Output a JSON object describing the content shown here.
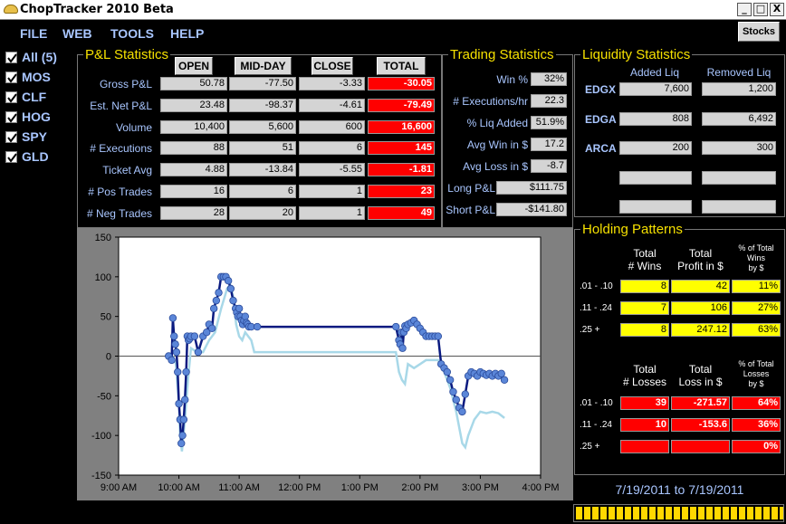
{
  "window": {
    "title": "ChopTracker 2010 Beta",
    "controls": [
      "_",
      "□",
      "X"
    ]
  },
  "menu": [
    "FILE",
    "WEB",
    "TOOLS",
    "HELP"
  ],
  "stocks_button": "Stocks",
  "tickers": [
    {
      "label": "All (5)",
      "checked": true
    },
    {
      "label": "MOS",
      "checked": true
    },
    {
      "label": "CLF",
      "checked": true
    },
    {
      "label": "HOG",
      "checked": true
    },
    {
      "label": "SPY",
      "checked": true
    },
    {
      "label": "GLD",
      "checked": true
    }
  ],
  "pl": {
    "title": "P&L Statistics",
    "columns": [
      "OPEN",
      "MID-DAY",
      "CLOSE",
      "TOTAL"
    ],
    "rows": [
      {
        "label": "Gross P&L",
        "values": [
          "50.78",
          "-77.50",
          "-3.33",
          "-30.05"
        ]
      },
      {
        "label": "Est. Net P&L",
        "values": [
          "23.48",
          "-98.37",
          "-4.61",
          "-79.49"
        ]
      },
      {
        "label": "Volume",
        "values": [
          "10,400",
          "5,600",
          "600",
          "16,600"
        ]
      },
      {
        "label": "# Executions",
        "values": [
          "88",
          "51",
          "6",
          "145"
        ]
      },
      {
        "label": "Ticket Avg",
        "values": [
          "4.88",
          "-13.84",
          "-5.55",
          "-1.81"
        ]
      },
      {
        "label": "# Pos Trades",
        "values": [
          "16",
          "6",
          "1",
          "23"
        ]
      },
      {
        "label": "# Neg Trades",
        "values": [
          "28",
          "20",
          "1",
          "49"
        ]
      }
    ]
  },
  "trading": {
    "title": "Trading Statistics",
    "rows": [
      {
        "label": "Win %",
        "value": "32%"
      },
      {
        "label": "# Executions/hr",
        "value": "22.3"
      },
      {
        "label": "% Liq Added",
        "value": "51.9%"
      },
      {
        "label": "Avg Win in $",
        "value": "17.2"
      },
      {
        "label": "Avg Loss in $",
        "value": "-8.7"
      },
      {
        "label": "Long P&L",
        "value": "$111.75"
      },
      {
        "label": "Short P&L",
        "value": "-$141.80"
      }
    ]
  },
  "liquidity": {
    "title": "Liquidity Statistics",
    "headers": [
      "Added Liq",
      "Removed Liq"
    ],
    "rows": [
      {
        "label": "EDGX",
        "added": "7,600",
        "removed": "1,200"
      },
      {
        "label": "EDGA",
        "added": "808",
        "removed": "6,492"
      },
      {
        "label": "ARCA",
        "added": "200",
        "removed": "300"
      },
      {
        "label": "",
        "added": "",
        "removed": ""
      },
      {
        "label": "",
        "added": "",
        "removed": ""
      }
    ]
  },
  "holding": {
    "title": "Holding Patterns",
    "wins_headers": [
      "Total\n# Wins",
      "Total\nProfit in $",
      "% of Total\nWins\nby $"
    ],
    "wins": [
      {
        "label": ".01 - .10",
        "values": [
          "8",
          "42",
          "11%"
        ]
      },
      {
        "label": ".11 - .24",
        "values": [
          "7",
          "106",
          "27%"
        ]
      },
      {
        "label": ".25 +",
        "values": [
          "8",
          "247.12",
          "63%"
        ]
      }
    ],
    "losses_headers": [
      "Total\n# Losses",
      "Total\nLoss in $",
      "% of Total\nLosses\nby $"
    ],
    "losses": [
      {
        "label": ".01 - .10",
        "values": [
          "39",
          "-271.57",
          "64%"
        ]
      },
      {
        "label": ".11 - .24",
        "values": [
          "10",
          "-153.6",
          "36%"
        ]
      },
      {
        "label": ".25 +",
        "values": [
          "",
          "",
          "0%"
        ]
      }
    ]
  },
  "date_range": "7/19/2011 to 7/19/2011",
  "progress_fraction": 1.0,
  "colors": {
    "accent": "#a9c6ff",
    "title": "#f5e000",
    "negative": "#ff0000",
    "highlight": "#ffff00",
    "line_dark": "#0a1a80",
    "line_light": "#a8d8e8",
    "marker": "#5b86d8"
  },
  "chart_data": {
    "type": "line",
    "xlim": [
      9.0,
      16.0
    ],
    "ylim": [
      -150,
      150
    ],
    "xticks": [
      "9:00 AM",
      "10:00 AM",
      "11:00 AM",
      "12:00 PM",
      "1:00 PM",
      "2:00 PM",
      "3:00 PM",
      "4:00 PM"
    ],
    "yticks": [
      "150",
      "100",
      "50",
      "0",
      "-50",
      "-100",
      "-150"
    ],
    "series": [
      {
        "style": "dark",
        "x": [
          9.83,
          9.88,
          9.9,
          9.92,
          9.94,
          9.96,
          9.98,
          10.0,
          10.02,
          10.04,
          10.06,
          10.08,
          10.1,
          10.12,
          10.14,
          10.16,
          10.18,
          10.2,
          10.26,
          10.32,
          10.4,
          10.46,
          10.5,
          10.55,
          10.58,
          10.62,
          10.66,
          10.7,
          10.74,
          10.78,
          10.82,
          10.86,
          10.9,
          10.94,
          10.96,
          10.98,
          11.0,
          11.02,
          11.04,
          11.06,
          11.08,
          11.1,
          11.12,
          11.14,
          11.16,
          11.2,
          11.3,
          12.5,
          13.6,
          13.65,
          13.67,
          13.69,
          13.71,
          13.73,
          13.75,
          13.77,
          13.8,
          13.85,
          13.9,
          13.95,
          14.0,
          14.05,
          14.1,
          14.15,
          14.2,
          14.25,
          14.3,
          14.35,
          14.4,
          14.45,
          14.5,
          14.55,
          14.6,
          14.65,
          14.7,
          14.75,
          14.8,
          14.85,
          14.9,
          14.95,
          15.0,
          15.05,
          15.1,
          15.15,
          15.2,
          15.25,
          15.3,
          15.35,
          15.4
        ],
        "y": [
          0,
          -5,
          48,
          25,
          15,
          5,
          -20,
          -60,
          -80,
          -110,
          -100,
          -80,
          -55,
          -20,
          25,
          20,
          22,
          25,
          25,
          5,
          25,
          30,
          40,
          35,
          60,
          70,
          80,
          100,
          100,
          100,
          95,
          85,
          70,
          60,
          55,
          50,
          60,
          50,
          45,
          40,
          45,
          50,
          42,
          40,
          37,
          37,
          37,
          37,
          37,
          20,
          15,
          30,
          10,
          30,
          38,
          35,
          40,
          42,
          45,
          40,
          35,
          30,
          25,
          25,
          25,
          25,
          25,
          -10,
          -15,
          -20,
          -30,
          -45,
          -55,
          -65,
          -70,
          -48,
          -25,
          -20,
          -22,
          -25,
          -20,
          -22,
          -24,
          -22,
          -25,
          -22,
          -25,
          -22,
          -30
        ]
      },
      {
        "style": "light",
        "x": [
          9.9,
          9.95,
          10.0,
          10.02,
          10.05,
          10.1,
          10.15,
          10.2,
          10.3,
          10.4,
          10.5,
          10.6,
          10.7,
          10.8,
          10.85,
          10.9,
          10.95,
          11.0,
          11.05,
          11.1,
          11.2,
          11.25,
          12.5,
          13.6,
          13.65,
          13.7,
          13.75,
          13.8,
          13.9,
          14.0,
          14.1,
          14.2,
          14.3,
          14.4,
          14.5,
          14.6,
          14.7,
          14.75,
          14.8,
          14.9,
          15.0,
          15.1,
          15.2,
          15.3,
          15.4
        ],
        "y": [
          0,
          -10,
          -60,
          -100,
          -120,
          -80,
          -30,
          10,
          5,
          5,
          20,
          30,
          60,
          85,
          90,
          75,
          40,
          25,
          20,
          30,
          20,
          5,
          5,
          5,
          -20,
          -30,
          -35,
          -10,
          -15,
          -10,
          -5,
          -5,
          -5,
          -20,
          -40,
          -70,
          -110,
          -115,
          -100,
          -80,
          -70,
          -72,
          -70,
          -72,
          -78
        ]
      }
    ]
  }
}
